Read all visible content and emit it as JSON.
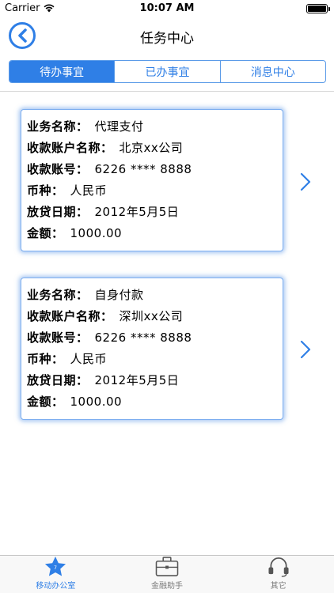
{
  "status_bar": {
    "carrier": "Carrier",
    "time": "10:07 AM"
  },
  "nav": {
    "title": "任务中心"
  },
  "segments": [
    {
      "label": "待办事宜",
      "active": true
    },
    {
      "label": "已办事宜",
      "active": false
    },
    {
      "label": "消息中心",
      "active": false
    }
  ],
  "cards": [
    {
      "rows": [
        {
          "label": "业务名称：",
          "value": "代理支付"
        },
        {
          "label": "收款账户名称：",
          "value": "北京xx公司"
        },
        {
          "label": "收款账号：",
          "value": "6226 **** 8888"
        },
        {
          "label": "币种：",
          "value": "人民币"
        },
        {
          "label": "放贷日期：",
          "value": "2012年5月5日"
        },
        {
          "label": "金额：",
          "value": "1000.00"
        }
      ]
    },
    {
      "rows": [
        {
          "label": "业务名称：",
          "value": "自身付款"
        },
        {
          "label": "收款账户名称：",
          "value": "深圳xx公司"
        },
        {
          "label": "收款账号：",
          "value": "6226 **** 8888"
        },
        {
          "label": "币种：",
          "value": "人民币"
        },
        {
          "label": "放贷日期：",
          "value": "2012年5月5日"
        },
        {
          "label": "金额：",
          "value": "1000.00"
        }
      ]
    }
  ],
  "tabbar": [
    {
      "label": "移动办公室",
      "icon": "star-icon",
      "active": true
    },
    {
      "label": "金融助手",
      "icon": "briefcase-icon",
      "active": false
    },
    {
      "label": "其它",
      "icon": "headset-icon",
      "active": false
    }
  ],
  "colors": {
    "accent": "#2f7fe6",
    "border": "#7eaff0"
  }
}
